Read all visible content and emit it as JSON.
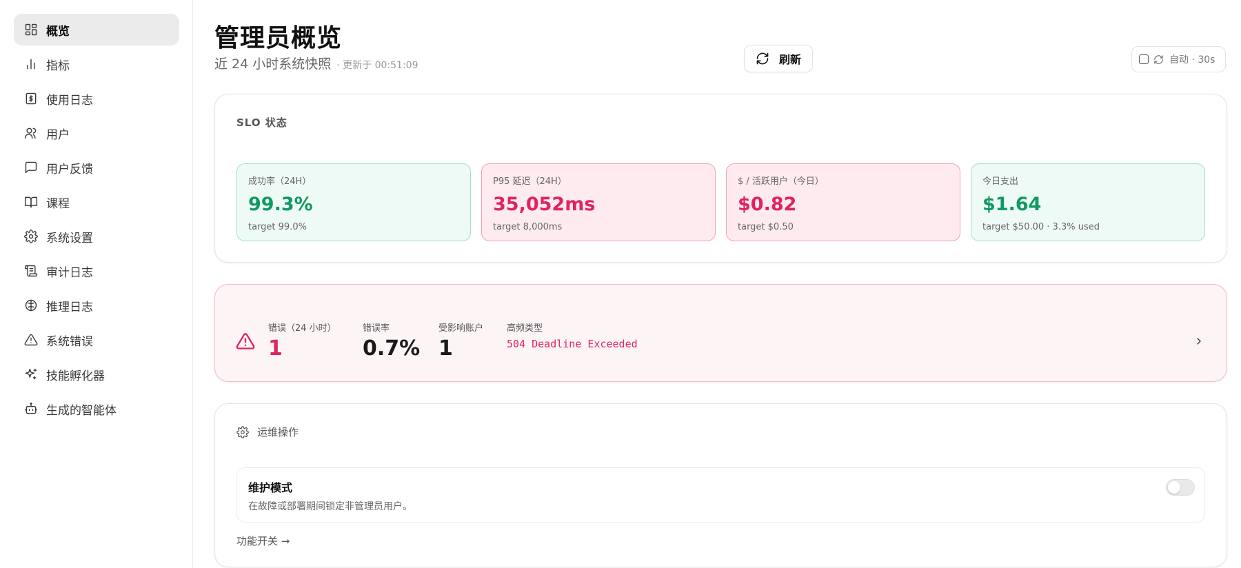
{
  "sidebar": {
    "items": [
      {
        "label": "概览",
        "icon": "grid-icon",
        "active": true
      },
      {
        "label": "指标",
        "icon": "bar-chart-icon"
      },
      {
        "label": "使用日志",
        "icon": "dollar-receipt-icon"
      },
      {
        "label": "用户",
        "icon": "users-icon"
      },
      {
        "label": "用户反馈",
        "icon": "message-icon"
      },
      {
        "label": "课程",
        "icon": "book-icon"
      },
      {
        "label": "系统设置",
        "icon": "gear-icon"
      },
      {
        "label": "审计日志",
        "icon": "scroll-icon"
      },
      {
        "label": "推理日志",
        "icon": "brain-icon"
      },
      {
        "label": "系统错误",
        "icon": "warning-icon"
      },
      {
        "label": "技能孵化器",
        "icon": "sparkles-icon"
      },
      {
        "label": "生成的智能体",
        "icon": "bot-icon"
      }
    ]
  },
  "header": {
    "title": "管理员概览",
    "subtitle": "近 24 小时系统快照",
    "updated": "· 更新于 00:51:09",
    "refresh_label": "刷新",
    "auto_label": "自动 · 30s"
  },
  "slo": {
    "title": "SLO 状态",
    "metrics": [
      {
        "label": "成功率（24H）",
        "value": "99.3%",
        "target": "target 99.0%",
        "status": "ok"
      },
      {
        "label": "P95 延迟（24H）",
        "value": "35,052ms",
        "target": "target 8,000ms",
        "status": "breach"
      },
      {
        "label": "$ / 活跃用户（今日）",
        "value": "$0.82",
        "target": "target $0.50",
        "status": "breach"
      },
      {
        "label": "今日支出",
        "value": "$1.64",
        "target": "target $50.00 · 3.3% used",
        "status": "ok"
      }
    ]
  },
  "errors": {
    "count_label": "错误（24 小时）",
    "count_value": "1",
    "rate_label": "错误率",
    "rate_value": "0.7%",
    "accounts_label": "受影响账户",
    "accounts_value": "1",
    "top_type_label": "高频类型",
    "top_type_value": "504 Deadline Exceeded"
  },
  "ops": {
    "title": "运维操作",
    "maintenance_title": "维护模式",
    "maintenance_desc": "在故障或部署期间锁定非管理员用户。",
    "maintenance_enabled": false,
    "feature_link": "功能开关 →"
  },
  "colors": {
    "ok": "#0f9a62",
    "breach": "#e0245e"
  }
}
